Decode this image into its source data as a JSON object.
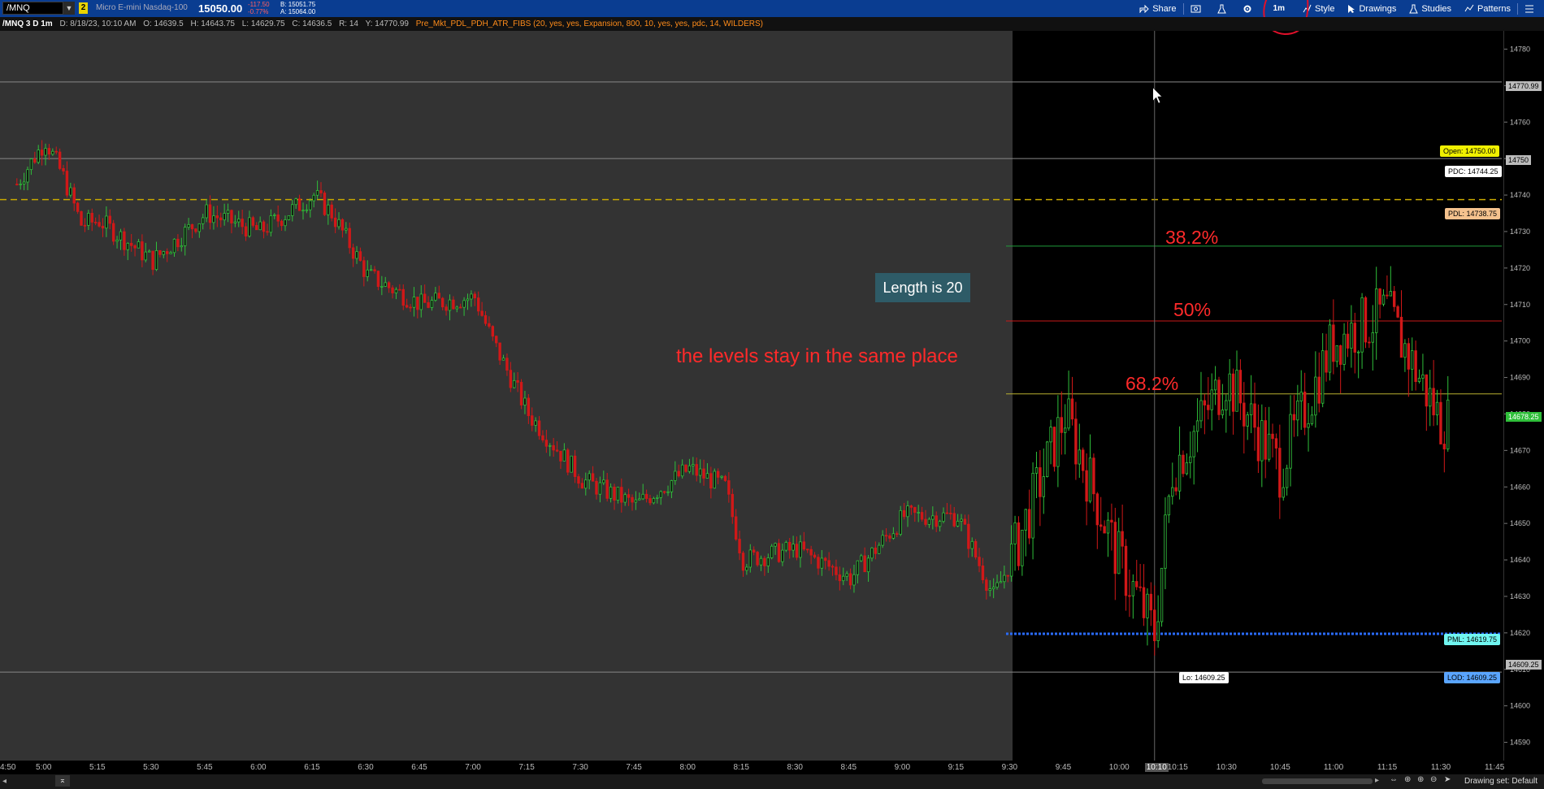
{
  "symbol": {
    "name": "/MNQ",
    "link": "2",
    "description": "Micro E-mini Nasdaq-100",
    "price": "15050.00",
    "change": "-117.50",
    "change_pct": "-0.77%",
    "bid": "B: 15051.75",
    "ask": "A: 15064.00"
  },
  "toolbar": {
    "share": "Share",
    "aggregation": "1m",
    "style": "Style",
    "drawings": "Drawings",
    "studies": "Studies",
    "patterns": "Patterns"
  },
  "infobar": {
    "chart_name": "/MNQ 3 D 1m",
    "date": "D: 8/18/23, 10:10 AM",
    "open": "O: 14639.5",
    "high": "H: 14643.75",
    "low": "L: 14629.75",
    "close": "C: 14636.5",
    "range": "R: 14",
    "y": "Y: 14770.99",
    "study": "Pre_Mkt_PDL_PDH_ATR_FIBS (20, yes, yes, Expansion, 800, 10, yes, yes, pdc, 14, WILDERS)"
  },
  "annotations": {
    "fib_382": "38.2%",
    "fib_50": "50%",
    "fib_682": "68.2%",
    "levels_text": "the levels stay in the same place",
    "length_box": "Length is 20"
  },
  "level_tags": {
    "open": "Open: 14750.00",
    "pdc": "PDC: 14744.25",
    "pdl": "PDL: 14738.75",
    "pml": "PML: 14619.75",
    "lod": "LOD: 14609.25",
    "lo": "Lo: 14609.25"
  },
  "price_tags": {
    "cursor": "14770.99",
    "hl_14750": "14750",
    "last": "14678.25",
    "lo_line": "14609.25"
  },
  "y_ticks": [
    "14780",
    "14770",
    "14760",
    "14750",
    "14740",
    "14730",
    "14720",
    "14710",
    "14700",
    "14690",
    "14680",
    "14670",
    "14660",
    "14650",
    "14640",
    "14630",
    "14620",
    "14610",
    "14600",
    "14590"
  ],
  "x_ticks": [
    "4:50",
    "5:00",
    "5:15",
    "5:30",
    "5:45",
    "6:00",
    "6:15",
    "6:30",
    "6:45",
    "7:00",
    "7:15",
    "7:30",
    "7:45",
    "8:00",
    "8:15",
    "8:30",
    "8:45",
    "9:00",
    "9:15",
    "9:30",
    "9:45",
    "10:00",
    "10:10",
    "10:15",
    "10:30",
    "10:45",
    "11:00",
    "11:15",
    "11:30",
    "11:45"
  ],
  "bottom": {
    "drawing_set": "Drawing set: Default"
  },
  "colors": {
    "up": "#2fbf3a",
    "down": "#d01818",
    "premarket_bg": "#333333",
    "accent": "#0a3d91",
    "fib_red": "#ff2a2a"
  },
  "chart_data": {
    "type": "candlestick",
    "ylim": [
      14585,
      14785
    ],
    "x_range": [
      "4:50",
      "11:45"
    ],
    "levels": [
      {
        "label": "Open",
        "value": 14750.0,
        "style": "solid-gray"
      },
      {
        "label": "PDC",
        "value": 14744.25
      },
      {
        "label": "PDL",
        "value": 14738.75,
        "style": "dashed-yellow"
      },
      {
        "label": "38.2%",
        "value": 14726.0,
        "style": "solid-green"
      },
      {
        "label": "50%",
        "value": 14705.5,
        "style": "solid-red"
      },
      {
        "label": "68.2%",
        "value": 14685.5,
        "style": "solid-yellow"
      },
      {
        "label": "PML",
        "value": 14619.75,
        "style": "dotted-blue"
      },
      {
        "label": "LOD",
        "value": 14609.25,
        "style": "solid-gray"
      }
    ],
    "close_path": [
      [
        "4:50",
        14740
      ],
      [
        "5:00",
        14755
      ],
      [
        "5:05",
        14745
      ],
      [
        "5:10",
        14732
      ],
      [
        "5:15",
        14733
      ],
      [
        "5:30",
        14722
      ],
      [
        "5:45",
        14735
      ],
      [
        "6:00",
        14730
      ],
      [
        "6:15",
        14740
      ],
      [
        "6:20",
        14735
      ],
      [
        "6:30",
        14718
      ],
      [
        "6:45",
        14710
      ],
      [
        "7:00",
        14712
      ],
      [
        "7:05",
        14700
      ],
      [
        "7:15",
        14680
      ],
      [
        "7:30",
        14662
      ],
      [
        "7:45",
        14655
      ],
      [
        "8:00",
        14665
      ],
      [
        "8:10",
        14660
      ],
      [
        "8:15",
        14640
      ],
      [
        "8:30",
        14643
      ],
      [
        "8:45",
        14635
      ],
      [
        "9:00",
        14652
      ],
      [
        "9:15",
        14652
      ],
      [
        "9:25",
        14630
      ],
      [
        "9:30",
        14640
      ],
      [
        "9:45",
        14680
      ],
      [
        "10:00",
        14640
      ],
      [
        "10:10",
        14620
      ],
      [
        "10:15",
        14665
      ],
      [
        "10:30",
        14690
      ],
      [
        "10:45",
        14665
      ],
      [
        "11:00",
        14700
      ],
      [
        "11:15",
        14708
      ],
      [
        "11:30",
        14678
      ]
    ]
  }
}
